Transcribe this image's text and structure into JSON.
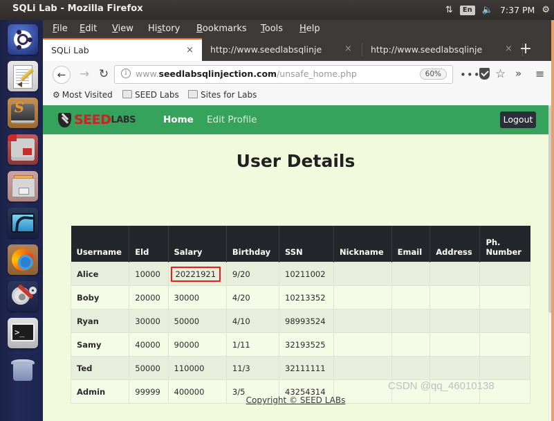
{
  "desktop": {
    "window_title": "SQLi Lab - Mozilla Firefox",
    "tray": {
      "network_icon": "network-updown-icon",
      "language": "En",
      "volume_icon": "volume-icon",
      "clock": "7:37 PM",
      "settings_icon": "gear-icon"
    },
    "launcher": [
      {
        "name": "ubuntu-dash-icon",
        "label": "Ubuntu Dash"
      },
      {
        "name": "text-editor-icon",
        "label": "Text Editor"
      },
      {
        "name": "sublime-text-icon",
        "label": "Sublime Text"
      },
      {
        "name": "terminator-icon",
        "label": "Terminator"
      },
      {
        "name": "file-manager-icon",
        "label": "Files"
      },
      {
        "name": "wireshark-icon",
        "label": "Wireshark"
      },
      {
        "name": "firefox-icon",
        "label": "Firefox"
      },
      {
        "name": "system-settings-icon",
        "label": "System Settings"
      },
      {
        "name": "terminal-icon",
        "label": "Terminal"
      },
      {
        "name": "trash-icon",
        "label": "Trash"
      }
    ]
  },
  "browser": {
    "menus": [
      "File",
      "Edit",
      "View",
      "History",
      "Bookmarks",
      "Tools",
      "Help"
    ],
    "tabs": [
      {
        "label": "SQLi Lab",
        "active": true,
        "close": "×"
      },
      {
        "label": "http://www.seedlabsqlinje",
        "active": false,
        "close": "×"
      },
      {
        "label": "http://www.seedlabsqlinje",
        "active": false,
        "close": "×"
      }
    ],
    "new_tab_label": "+",
    "nav": {
      "back": "←",
      "forward": "→",
      "reload": "↻",
      "info_icon": "i",
      "url_prefix": "www.",
      "url_domain": "seedlabsqlinjection.com",
      "url_path": "/unsafe_home.php",
      "zoom_level": "60%",
      "more_dots": "•••",
      "shield_icon": "shield-icon",
      "star_icon": "☆",
      "overflow_icon": "»",
      "menu_icon": "≡"
    },
    "bookmarks": [
      {
        "icon": "⚙",
        "label": "Most Visited"
      },
      {
        "icon": "folder-icon",
        "label": "SEED Labs"
      },
      {
        "icon": "folder-icon",
        "label": "Sites for Labs"
      }
    ]
  },
  "site": {
    "brand": {
      "seed": "SEED",
      "labs": "LABS",
      "shield_icon": "seed-shield-icon"
    },
    "nav": [
      {
        "label": "Home",
        "active": true
      },
      {
        "label": "Edit Profile",
        "active": false
      }
    ],
    "logout_label": "Logout",
    "page_title": "User Details",
    "copyright": "Copyright © SEED LABs",
    "watermark": "CSDN @qq_46010138",
    "colors": {
      "nav_green": "#35a35c",
      "page_bg": "#f2fade",
      "table_header": "#23272b",
      "row_odd": "#e8eedc",
      "row_even": "#f4fbe6",
      "highlight_border": "#ee1b1b"
    }
  },
  "table": {
    "columns": [
      "Username",
      "Eld",
      "Salary",
      "Birthday",
      "SSN",
      "Nickname",
      "Email",
      "Address",
      "Ph. Number"
    ],
    "rows": [
      {
        "username": "Alice",
        "eld": "10000",
        "salary": "20221921",
        "birthday": "9/20",
        "ssn": "10211002",
        "nickname": "",
        "email": "",
        "address": "",
        "phone": "",
        "salary_highlighted": true
      },
      {
        "username": "Boby",
        "eld": "20000",
        "salary": "30000",
        "birthday": "4/20",
        "ssn": "10213352",
        "nickname": "",
        "email": "",
        "address": "",
        "phone": "",
        "salary_highlighted": false
      },
      {
        "username": "Ryan",
        "eld": "30000",
        "salary": "50000",
        "birthday": "4/10",
        "ssn": "98993524",
        "nickname": "",
        "email": "",
        "address": "",
        "phone": "",
        "salary_highlighted": false
      },
      {
        "username": "Samy",
        "eld": "40000",
        "salary": "90000",
        "birthday": "1/11",
        "ssn": "32193525",
        "nickname": "",
        "email": "",
        "address": "",
        "phone": "",
        "salary_highlighted": false
      },
      {
        "username": "Ted",
        "eld": "50000",
        "salary": "110000",
        "birthday": "11/3",
        "ssn": "32111111",
        "nickname": "",
        "email": "",
        "address": "",
        "phone": "",
        "salary_highlighted": false
      },
      {
        "username": "Admin",
        "eld": "99999",
        "salary": "400000",
        "birthday": "3/5",
        "ssn": "43254314",
        "nickname": "",
        "email": "",
        "address": "",
        "phone": "",
        "salary_highlighted": false
      }
    ]
  }
}
